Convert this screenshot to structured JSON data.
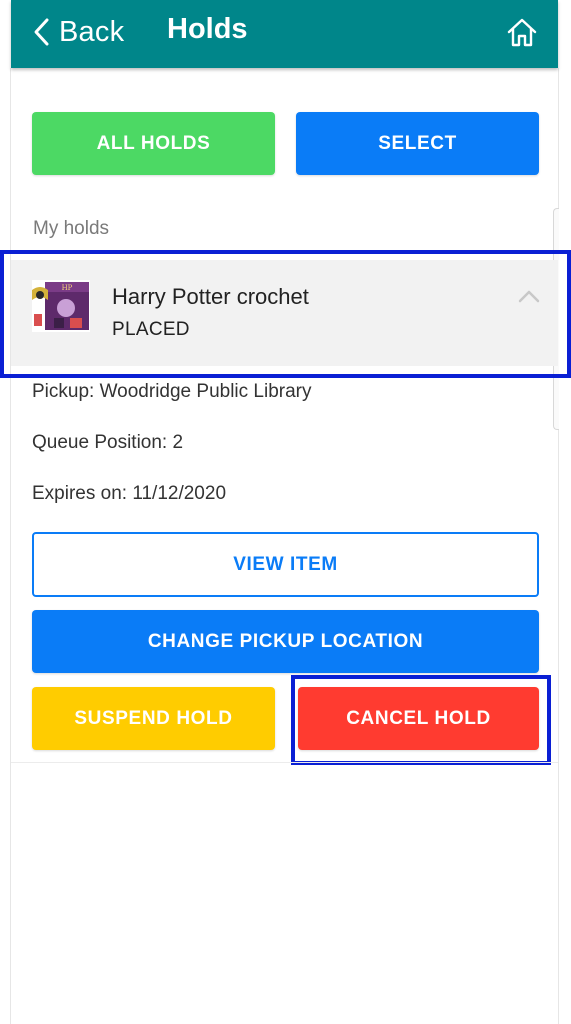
{
  "header": {
    "back_label": "Back",
    "title": "Holds",
    "background_color": "#00868a",
    "back_icon": "chevron-left-icon",
    "home_icon": "home-icon"
  },
  "actions": {
    "all_holds_label": "ALL HOLDS",
    "select_label": "SELECT"
  },
  "section": {
    "label": "My holds"
  },
  "hold": {
    "title": "Harry Potter crochet",
    "status": "PLACED",
    "cover_icon": "book-cover-thumbnail",
    "collapse_icon": "chevron-up-icon",
    "pickup": "Pickup: Woodridge Public Library",
    "queue_position": "Queue Position: 2",
    "expires": "Expires on: 11/12/2020"
  },
  "hold_actions": {
    "view_item_label": "VIEW ITEM",
    "change_pickup_label": "CHANGE PICKUP LOCATION",
    "suspend_label": "SUSPEND HOLD",
    "cancel_label": "CANCEL HOLD"
  },
  "colors": {
    "green": "#4cd964",
    "blue": "#0a7cf7",
    "yellow": "#ffcc00",
    "red": "#ff3b30",
    "highlight": "#0a1fd4"
  }
}
